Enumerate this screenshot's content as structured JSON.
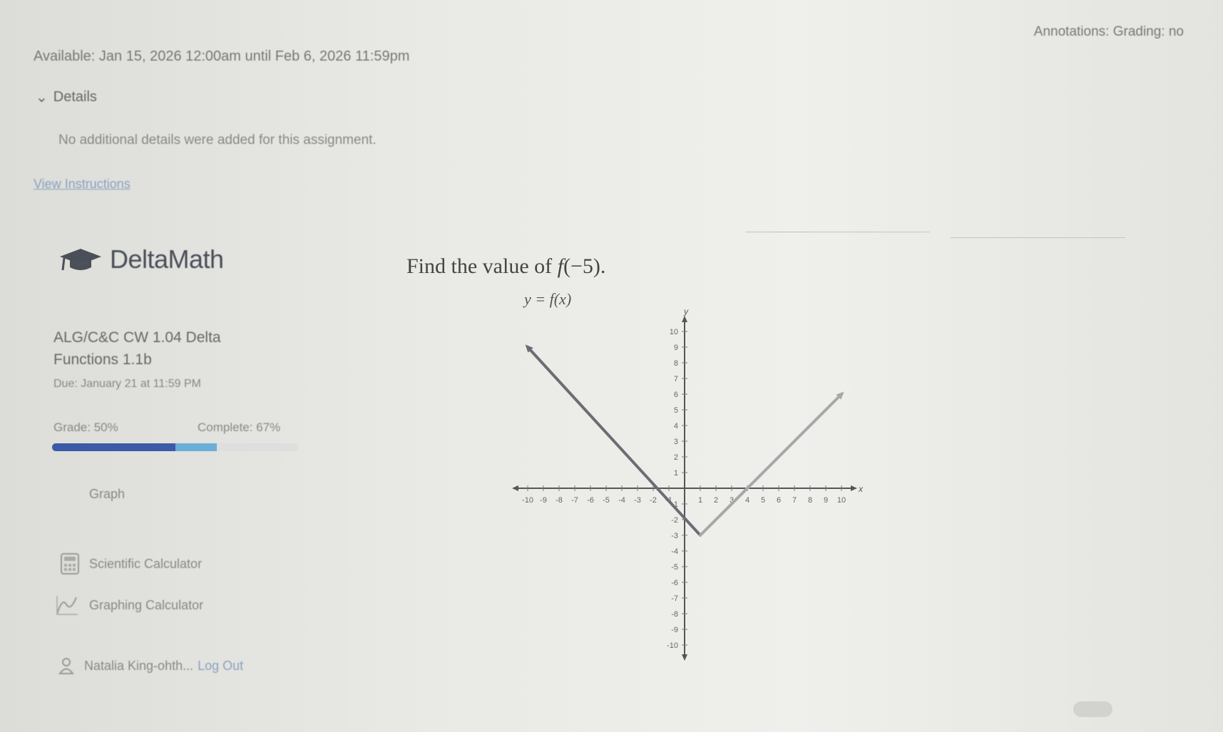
{
  "header": {
    "annotations_label": "Annotations: Grading: no",
    "available_text": "Available: Jan 15, 2026 12:00am until Feb 6, 2026 11:59pm",
    "details_label": "Details",
    "details_body": "No additional details were added for this assignment.",
    "view_link": "View Instructions"
  },
  "sidebar": {
    "brand_name": "DeltaMath",
    "assignment_title": "ALG/C&C CW 1.04 Delta Functions 1.1b",
    "due_text": "Due: January 21 at 11:59 PM",
    "grade_text": "Grade: 50%",
    "complete_text": "Complete: 67%",
    "grade_fraction": 0.5,
    "complete_fraction": 0.67,
    "graph_link": "Graph",
    "tools": [
      {
        "label": "Scientific Calculator",
        "icon": "calculator-icon"
      },
      {
        "label": "Graphing Calculator",
        "icon": "graph-icon"
      }
    ],
    "user_name": "Natalia King-ohth...",
    "logout": "Log Out"
  },
  "question": {
    "prompt": "Find the value of ",
    "fn": "f",
    "arg": "(−5)."
  },
  "chart_data": {
    "type": "line",
    "title": "y = f(x)",
    "xlabel": "x",
    "ylabel": "y",
    "xlim": [
      -10,
      10
    ],
    "ylim": [
      -10,
      10
    ],
    "x_ticks": [
      -10,
      -9,
      -8,
      -7,
      -6,
      -5,
      -4,
      -3,
      -2,
      -1,
      1,
      2,
      3,
      4,
      5,
      6,
      7,
      8,
      9,
      10
    ],
    "y_ticks": [
      -10,
      -9,
      -8,
      -7,
      -6,
      -5,
      -4,
      -3,
      -2,
      -1,
      1,
      2,
      3,
      4,
      5,
      6,
      7,
      8,
      9,
      10
    ],
    "grid": false,
    "series": [
      {
        "x": [
          -10,
          1
        ],
        "y": [
          9,
          -3
        ],
        "arrow_start": true,
        "color": "#6c6c74"
      },
      {
        "x": [
          1,
          10
        ],
        "y": [
          -3,
          6
        ],
        "arrow_end": true,
        "color": "#a8a8a8"
      }
    ]
  },
  "colors": {
    "progress_grade": "#3b5aa8",
    "progress_complete": "#6aaed9",
    "link": "#8aa3c0"
  }
}
